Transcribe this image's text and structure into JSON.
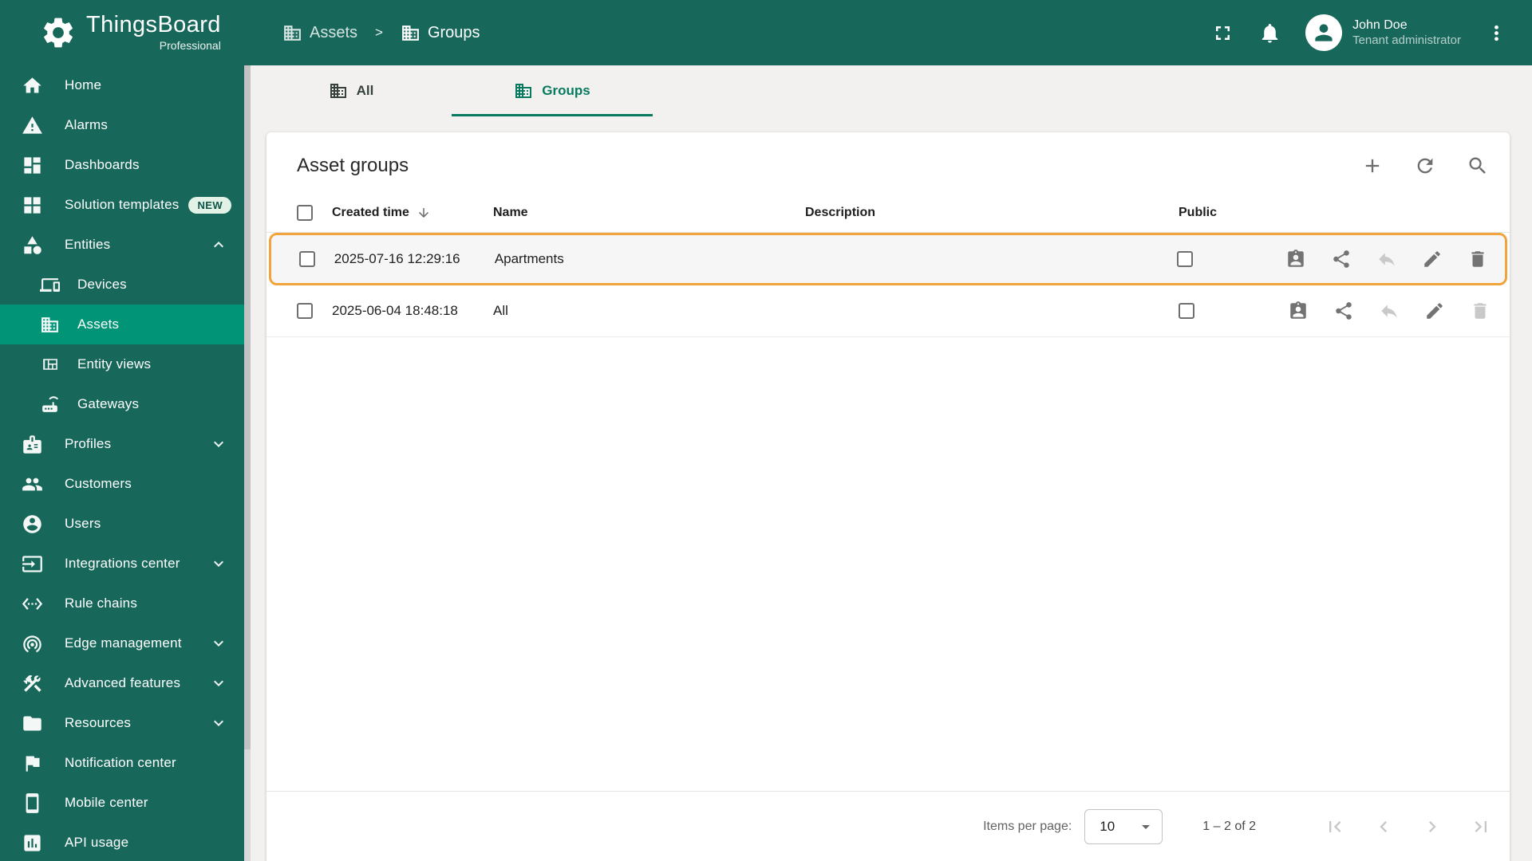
{
  "app": {
    "title": "ThingsBoard",
    "subtitle": "Professional"
  },
  "breadcrumb": {
    "level1": "Assets",
    "separator": ">",
    "level2": "Groups"
  },
  "user": {
    "name": "John Doe",
    "role": "Tenant administrator"
  },
  "sidebar": {
    "items": [
      {
        "label": "Home"
      },
      {
        "label": "Alarms"
      },
      {
        "label": "Dashboards"
      },
      {
        "label": "Solution templates",
        "badge": "NEW"
      },
      {
        "label": "Entities",
        "expanded": true
      },
      {
        "label": "Devices"
      },
      {
        "label": "Assets",
        "active": true
      },
      {
        "label": "Entity views"
      },
      {
        "label": "Gateways"
      },
      {
        "label": "Profiles"
      },
      {
        "label": "Customers"
      },
      {
        "label": "Users"
      },
      {
        "label": "Integrations center"
      },
      {
        "label": "Rule chains"
      },
      {
        "label": "Edge management"
      },
      {
        "label": "Advanced features"
      },
      {
        "label": "Resources"
      },
      {
        "label": "Notification center"
      },
      {
        "label": "Mobile center"
      },
      {
        "label": "API usage"
      }
    ]
  },
  "tabs": {
    "all": "All",
    "groups": "Groups"
  },
  "table": {
    "title": "Asset groups",
    "columns": {
      "created": "Created time",
      "name": "Name",
      "description": "Description",
      "public": "Public"
    },
    "rows": [
      {
        "created": "2025-07-16 12:29:16",
        "name": "Apartments",
        "description": "",
        "public": false,
        "highlighted": true
      },
      {
        "created": "2025-06-04 18:48:18",
        "name": "All",
        "description": "",
        "public": false,
        "highlighted": false
      }
    ]
  },
  "pagination": {
    "items_per_page_label": "Items per page:",
    "page_size": "10",
    "range": "1 – 2 of 2"
  },
  "icons": {
    "logo": "gear-icon",
    "breadcrumb": "building-icon",
    "header": [
      "fullscreen-icon",
      "notifications-bell-icon",
      "avatar-person-icon",
      "more-vertical-icon"
    ],
    "card_actions": [
      "add-plus-icon",
      "refresh-icon",
      "search-icon"
    ],
    "table_header": [
      "sort-descending-arrow-icon"
    ],
    "row_actions": [
      "group-users-icon",
      "share-icon",
      "make-private-icon",
      "edit-pencil-icon",
      "delete-trash-icon"
    ],
    "paginator": [
      "dropdown-caret-icon",
      "first-page-icon",
      "previous-page-icon",
      "next-page-icon",
      "last-page-icon"
    ]
  },
  "colors": {
    "primary": "#17685a",
    "sidebar_selected": "#029476",
    "tab_accent": "#077a5f",
    "highlight_border": "#f1a43b",
    "content_background": "#f2f1ef"
  }
}
